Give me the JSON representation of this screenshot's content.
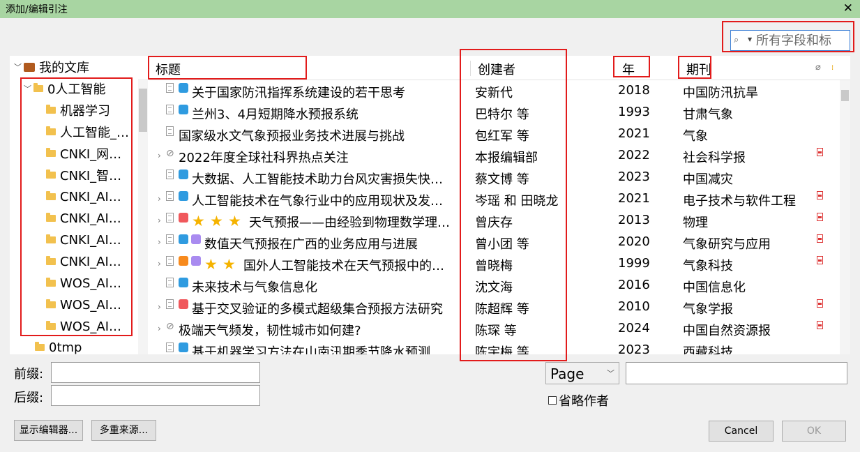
{
  "dialog": {
    "title": "添加/编辑引注",
    "close_glyph": "✕"
  },
  "search": {
    "placeholder": "所有字段和标"
  },
  "library": {
    "root_label": "我的文库",
    "top_folder": "0人工智能",
    "subfolders": [
      "机器学习",
      "人工智能_…",
      "CNKI_网…",
      "CNKI_智…",
      "CNKI_AI…",
      "CNKI_AI…",
      "CNKI_AI…",
      "CNKI_AI…",
      "WOS_AI…",
      "WOS_AI…",
      "WOS_AI…"
    ],
    "next_folder": "0tmp"
  },
  "columns": {
    "title": "标题",
    "creator": "创建者",
    "year": "年",
    "publication": "期刊"
  },
  "items": [
    {
      "title": "关于国家防汛指挥系统建设的若干思考",
      "creator": "安新代",
      "year": "2018",
      "publication": "中国防汛抗旱"
    },
    {
      "title": "兰州3、4月短期降水预报系统",
      "creator": "巴特尔 等",
      "year": "1993",
      "publication": "甘肃气象"
    },
    {
      "title": "国家级水文气象预报业务技术进展与挑战",
      "creator": "包红军 等",
      "year": "2021",
      "publication": "气象"
    },
    {
      "title": "2022年度全球社科界热点关注",
      "creator": "本报编辑部",
      "year": "2022",
      "publication": "社会科学报"
    },
    {
      "title": "大数据、人工智能技术助力台风灾害损失快…",
      "creator": "蔡文博 等",
      "year": "2023",
      "publication": "中国减灾"
    },
    {
      "title": "人工智能技术在气象行业中的应用现状及发…",
      "creator": "岑瑶 和 田晓龙",
      "year": "2021",
      "publication": "电子技术与软件工程"
    },
    {
      "title": "天气预报——由经验到物理数学理…",
      "creator": "曾庆存",
      "year": "2013",
      "publication": "物理"
    },
    {
      "title": "数值天气预报在广西的业务应用与进展",
      "creator": "曾小团 等",
      "year": "2020",
      "publication": "气象研究与应用"
    },
    {
      "title": "国外人工智能技术在天气预报中的…",
      "creator": "曾晓梅",
      "year": "1999",
      "publication": "气象科技"
    },
    {
      "title": "未来技术与气象信息化",
      "creator": "沈文海",
      "year": "2016",
      "publication": "中国信息化"
    },
    {
      "title": "基于交叉验证的多模式超级集合预报方法研究",
      "creator": "陈超辉 等",
      "year": "2010",
      "publication": "气象学报"
    },
    {
      "title": "极端天气频发，韧性城市如何建?",
      "creator": "陈琛 等",
      "year": "2024",
      "publication": "中国自然资源报"
    },
    {
      "title": "基于机器学习方法在山南汛期季节降水预测",
      "creator": "陈宇梅 等",
      "year": "2023",
      "publication": "西藏科技"
    }
  ],
  "colors": {
    "tag_blue": "#2f9be0",
    "tag_red": "#f0585c",
    "tag_purple": "#a98bf0",
    "tag_orange": "#f78a1d",
    "star": "#f5b300",
    "highlight": "#e21b1b"
  },
  "form": {
    "prefix_label": "前缀:",
    "suffix_label": "后缀:",
    "locator_value": "Page",
    "omit_author_label": "省略作者",
    "show_editor_button": "显示编辑器...",
    "multiple_sources_button": "多重来源...",
    "cancel_button": "Cancel",
    "ok_button": "OK"
  }
}
